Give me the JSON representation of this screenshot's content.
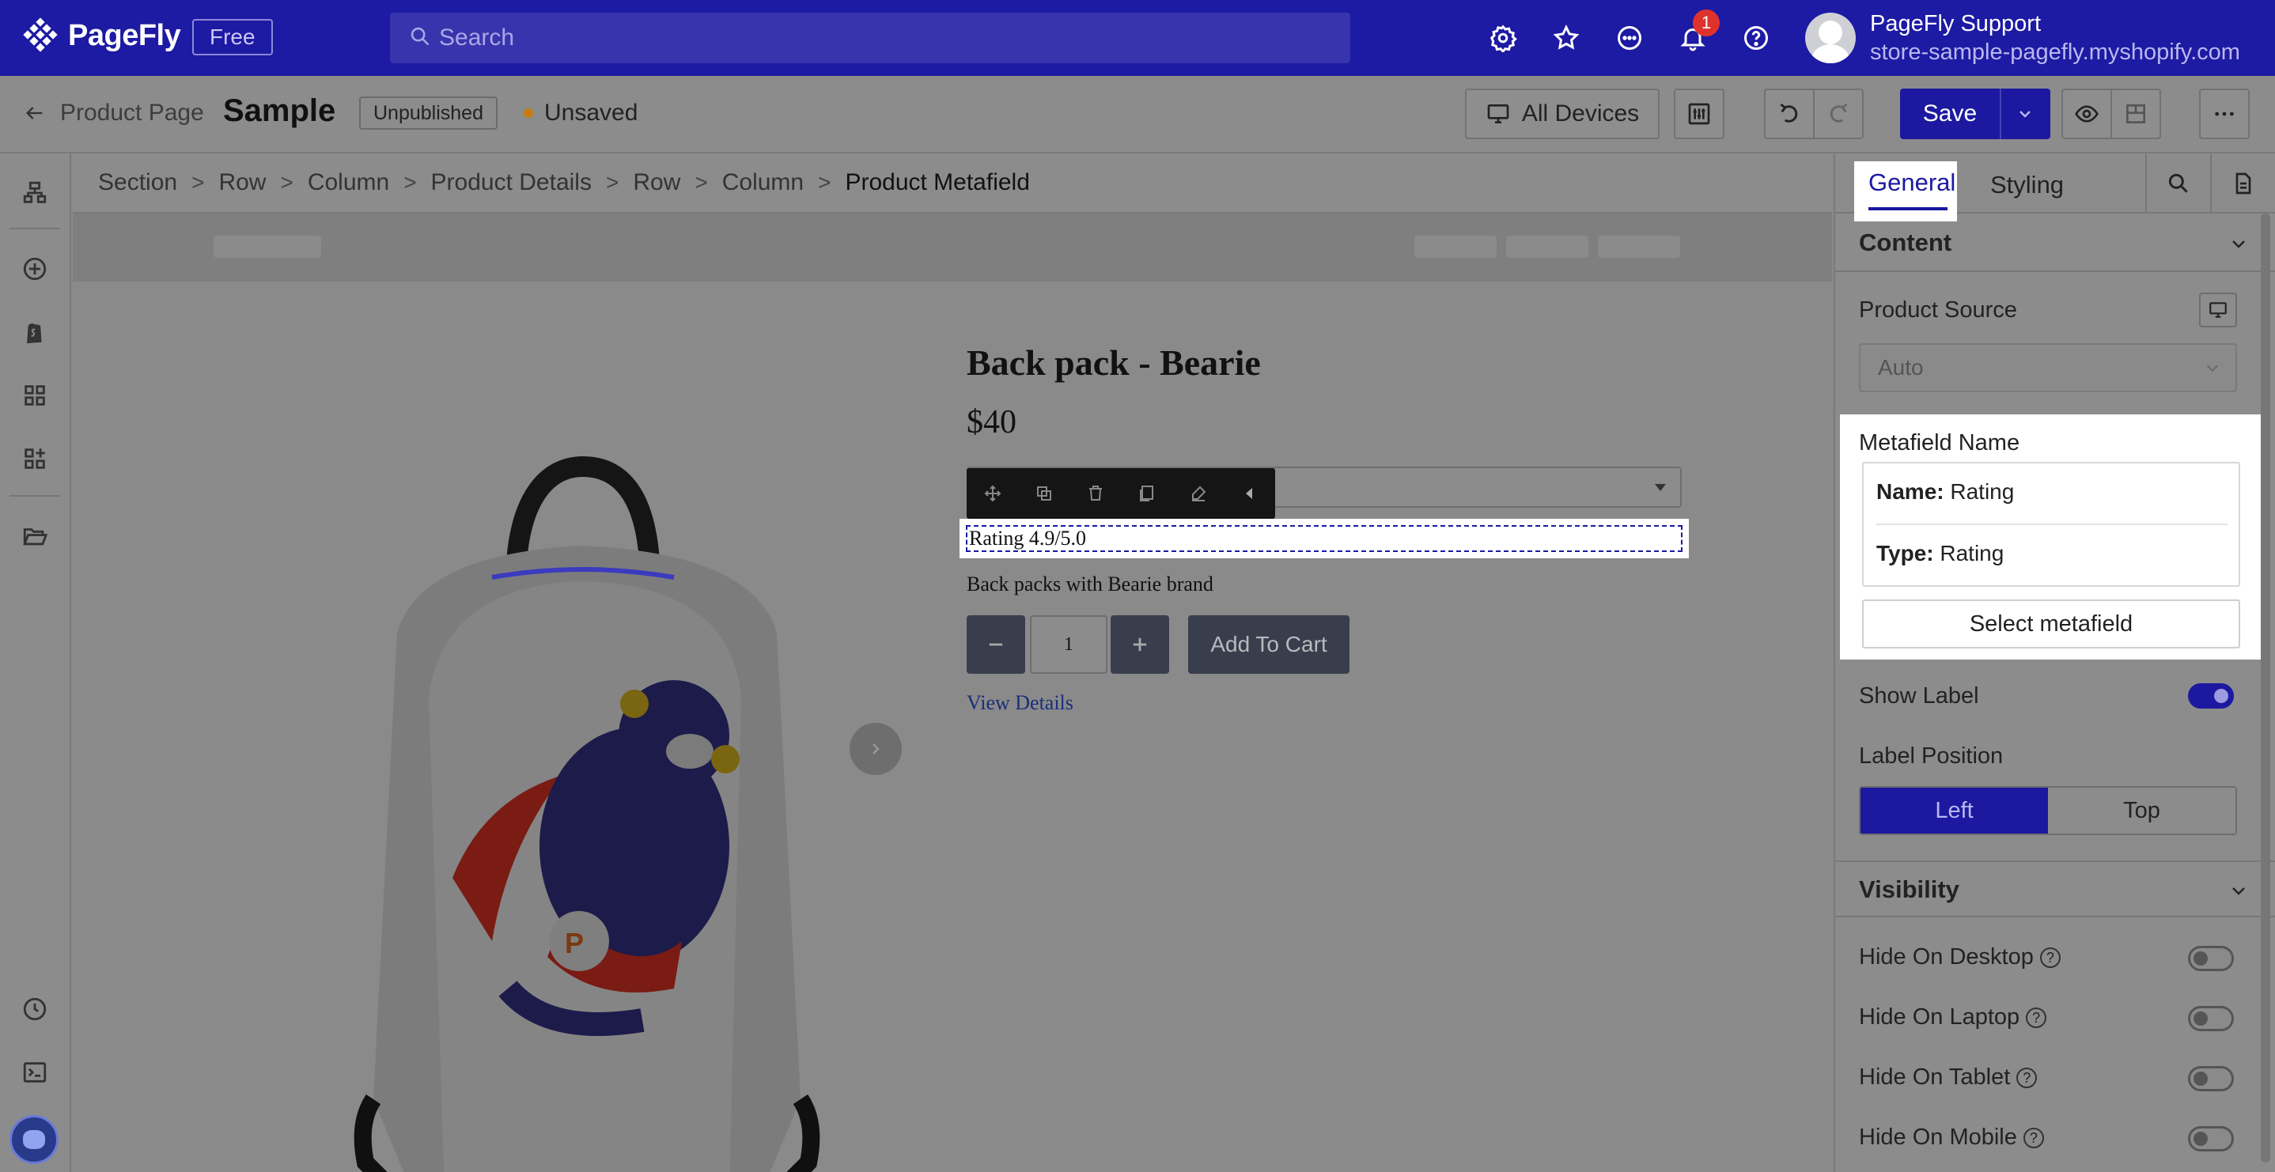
{
  "app": {
    "logo_text": "PageFly",
    "plan_badge": "Free",
    "search_placeholder": "Search",
    "notification_count": "1",
    "account_name": "PageFly Support",
    "account_store": "store-sample-pagefly.myshopify.com",
    "brand_color": "#1d1aa3"
  },
  "pagebar": {
    "back_label": "Product Page",
    "page_title": "Sample",
    "status_badge": "Unpublished",
    "save_status": "Unsaved",
    "device_label": "All Devices",
    "save_label": "Save"
  },
  "breadcrumb": [
    "Section",
    "Row",
    "Column",
    "Product Details",
    "Row",
    "Column",
    "Product Metafield"
  ],
  "product": {
    "title": "Back pack - Bearie",
    "price": "$40",
    "rating_text": "Rating  4.9/5.0",
    "description": "Back packs with Bearie brand",
    "quantity": "1",
    "add_to_cart": "Add To Cart",
    "view_details": "View Details"
  },
  "panel": {
    "tabs": [
      "General",
      "Styling"
    ],
    "content_section": "Content",
    "product_source_label": "Product Source",
    "product_source_value": "Auto",
    "metafield_title": "Metafield Name",
    "metafield_name_label": "Name:",
    "metafield_name_value": "Rating",
    "metafield_type_label": "Type:",
    "metafield_type_value": "Rating",
    "select_metafield": "Select metafield",
    "show_label": "Show Label",
    "show_label_on": true,
    "label_position": "Label Position",
    "label_position_options": [
      "Left",
      "Top"
    ],
    "label_position_selected": "Left",
    "visibility_section": "Visibility",
    "hide_desktop": "Hide On Desktop",
    "hide_laptop": "Hide On Laptop",
    "hide_tablet": "Hide On Tablet",
    "hide_mobile": "Hide On Mobile",
    "help_glyph": "?"
  }
}
